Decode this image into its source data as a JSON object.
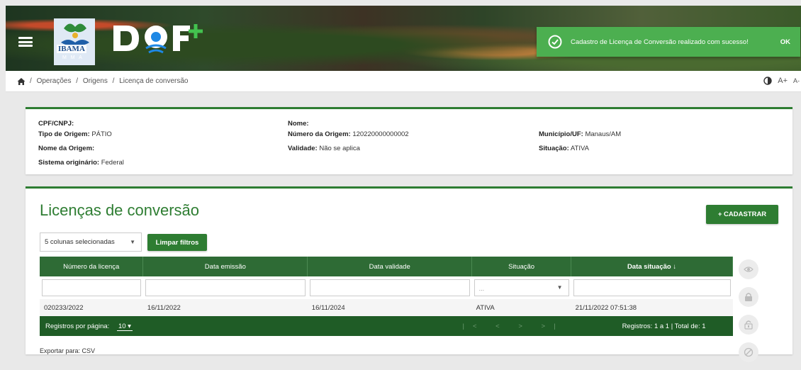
{
  "header": {
    "logo_text": "IBAMA",
    "logo_sub": "M M A",
    "app_logo": "DOF+"
  },
  "toast": {
    "message": "Cadastro de Licença de Conversão realizado com sucesso!",
    "ok_label": "OK",
    "icon": "check-circle-icon"
  },
  "breadcrumb": {
    "items": [
      "Operações",
      "Origens",
      "Licença de conversão"
    ]
  },
  "accessibility": {
    "font_up": "A+",
    "font_down": "A-"
  },
  "info": {
    "cpf_label": "CPF/CNPJ:",
    "cpf_value": "",
    "tipo_label": "Tipo de Origem:",
    "tipo_value": "PÁTIO",
    "nome_origem_label": "Nome da Origem:",
    "nome_origem_value": "",
    "sistema_label": "Sistema originário:",
    "sistema_value": "Federal",
    "nome_label": "Nome:",
    "nome_value": "",
    "numero_label": "Número da Origem:",
    "numero_value": "120220000000002",
    "validade_label": "Validade:",
    "validade_value": "Não se aplica",
    "municipio_label": "Município/UF:",
    "municipio_value": "Manaus/AM",
    "situacao_label": "Situação:",
    "situacao_value": "ATIVA"
  },
  "list": {
    "title": "Licenças de conversão",
    "add_button": "+ CADASTRAR",
    "columns_select": "5 colunas selecionadas",
    "clear_filters": "Limpar filtros",
    "columns": [
      "Número da licença",
      "Data emissão",
      "Data validade",
      "Situação",
      "Data situação ↓"
    ],
    "situacao_filter_placeholder": "...",
    "rows": [
      [
        "020233/2022",
        "16/11/2022",
        "16/11/2024",
        "ATIVA",
        "21/11/2022 07:51:38"
      ]
    ],
    "footer": {
      "per_page_label": "Registros por página:",
      "per_page_value": "10",
      "nav": "|<  <  >  >|",
      "summary": "Registros: 1 a 1 | Total de: 1"
    },
    "export_label": "Exportar para:",
    "export_csv": "CSV"
  },
  "colors": {
    "primary_green": "#2e7d32",
    "toast_green": "#4caf50",
    "table_header": "#2e6b35"
  }
}
